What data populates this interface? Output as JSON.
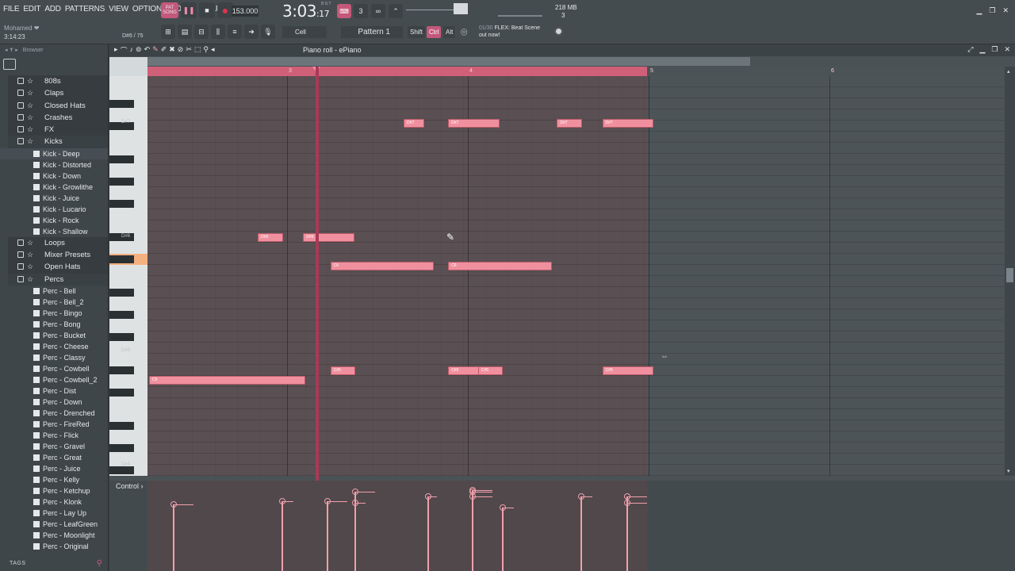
{
  "menu": [
    "FILE",
    "EDIT",
    "ADD",
    "PATTERNS",
    "VIEW",
    "OPTIONS",
    "TOOLS",
    "HELP"
  ],
  "user": "Mohamed ❤",
  "song_time_small": "3:14:23",
  "transport": {
    "pat_label": "PAT",
    "song_label": "SONG",
    "tempo": "153.000"
  },
  "clock": {
    "main": "3:03",
    "sub": "17",
    "label": "B:S:T"
  },
  "memory": {
    "mb": "218 MB",
    "cpu": "3"
  },
  "hint_text": "D#6 / 75",
  "snap": {
    "label": "Cell"
  },
  "pattern": {
    "label": "Pattern 1"
  },
  "modifiers": {
    "shift": "Shift",
    "ctrl": "Ctrl",
    "alt": "Alt"
  },
  "news": {
    "counter": "01/30",
    "line1": "FLEX: Beat Scene",
    "line2": "out now!"
  },
  "browser": {
    "title": "Browser",
    "tags_label": "TAGS",
    "folders_top": [
      "808s",
      "Claps",
      "Closed Hats",
      "Crashes",
      "FX",
      "Kicks"
    ],
    "kicks": [
      "Kick - Deep",
      "Kick - Distorted",
      "Kick - Down",
      "Kick - Growlithe",
      "Kick - Juice",
      "Kick - Lucario",
      "Kick - Rock",
      "Kick - Shallow"
    ],
    "folders_mid": [
      "Loops",
      "Mixer Presets",
      "Open Hats",
      "Percs"
    ],
    "percs": [
      "Perc - Bell",
      "Perc - Bell_2",
      "Perc - Bingo",
      "Perc - Bong",
      "Perc - Bucket",
      "Perc - Cheese",
      "Perc - Classy",
      "Perc - Cowbell",
      "Perc - Cowbell_2",
      "Perc - Dist",
      "Perc - Down",
      "Perc - Drenched",
      "Perc - FireRed",
      "Perc - Flick",
      "Perc - Gravel",
      "Perc - Great",
      "Perc - Juice",
      "Perc - Kelly",
      "Perc - Ketchup",
      "Perc - Klonk",
      "Perc - Lay Up",
      "Perc - LeafGreen",
      "Perc - Moonlight",
      "Perc - Original"
    ]
  },
  "pianoroll": {
    "title": "Piano roll - ePiano",
    "ruler_numbers": [
      "3",
      "4",
      "5",
      "6"
    ],
    "key_labels": [
      "D#7",
      "D#6",
      "D#5",
      "D#4"
    ],
    "control_label": "Control",
    "notes": [
      {
        "label": "D#7",
        "start": 2.81,
        "length": 0.13,
        "row": 0
      },
      {
        "label": "D#7",
        "start": 3.3,
        "length": 0.33,
        "row": 0
      },
      {
        "label": "D#7",
        "start": 4.5,
        "length": 0.16,
        "row": 0
      },
      {
        "label": "D#7",
        "start": 5.0,
        "length": 0.33,
        "row": 0
      },
      {
        "label": "D#6",
        "start": 1.2,
        "length": 0.16,
        "row": 1
      },
      {
        "label": "D#6",
        "start": 1.7,
        "length": 0.33,
        "row": 1
      },
      {
        "label": "C6",
        "start": 2.0,
        "length": 1.3,
        "row": 2
      },
      {
        "label": "C6",
        "start": 3.3,
        "length": 1.3,
        "row": 2
      },
      {
        "label": "C#5",
        "start": 2.0,
        "length": 0.16,
        "row": 3
      },
      {
        "label": "C#5",
        "start": 3.3,
        "length": 0.33,
        "row": 3
      },
      {
        "label": "C#5",
        "start": 3.63,
        "length": 0.16,
        "row": 3
      },
      {
        "label": "C#5",
        "start": 5.0,
        "length": 0.33,
        "row": 3
      },
      {
        "label": "C5",
        "start": 0.0,
        "length": 1.0,
        "row": 4
      }
    ]
  },
  "colors": {
    "accent": "#c4587a",
    "note": "#f0909e",
    "ruler": "#cf6078",
    "playhead": "#a83a58"
  }
}
